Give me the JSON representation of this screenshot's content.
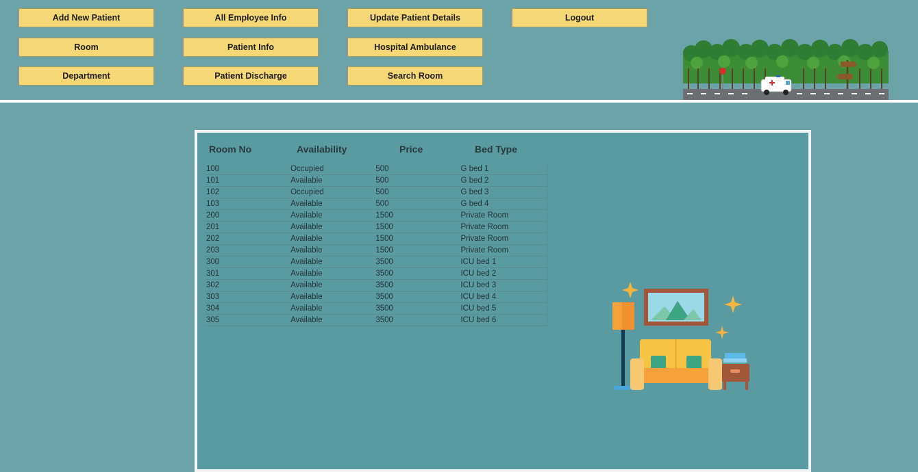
{
  "toolbar": {
    "add_new_patient": "Add New Patient",
    "all_employee_info": "All Employee Info",
    "update_patient_details": "Update Patient Details",
    "logout": "Logout",
    "room": "Room",
    "patient_info": "Patient Info",
    "hospital_ambulance": "Hospital Ambulance",
    "department": "Department",
    "patient_discharge": "Patient Discharge",
    "search_room": "Search Room"
  },
  "room_table": {
    "headers": [
      "Room No",
      "Availability",
      "Price",
      "Bed Type"
    ],
    "rows": [
      [
        "100",
        "Occupied",
        "500",
        "G bed 1"
      ],
      [
        "101",
        "Available",
        "500",
        "G bed 2"
      ],
      [
        "102",
        "Occupied",
        "500",
        "G bed 3"
      ],
      [
        "103",
        "Available",
        "500",
        "G bed 4"
      ],
      [
        "200",
        "Available",
        "1500",
        "Private Room"
      ],
      [
        "201",
        "Available",
        "1500",
        "Private Room"
      ],
      [
        "202",
        "Available",
        "1500",
        "Private Room"
      ],
      [
        "203",
        "Available",
        "1500",
        "Private Room"
      ],
      [
        "300",
        "Available",
        "3500",
        "ICU bed 1"
      ],
      [
        "301",
        "Available",
        "3500",
        "ICU bed 2"
      ],
      [
        "302",
        "Available",
        "3500",
        "ICU bed 3"
      ],
      [
        "303",
        "Available",
        "3500",
        "ICU bed 4"
      ],
      [
        "304",
        "Available",
        "3500",
        "ICU bed 5"
      ],
      [
        "305",
        "Available",
        "3500",
        "ICU bed 6"
      ]
    ]
  },
  "icons": {
    "header_scene": "ambulance-road-forest-illustration",
    "room_illustration": "sofa-living-room-illustration"
  },
  "colors": {
    "page_bg": "#6ca3a8",
    "panel_bg": "#5a9ba2",
    "button_bg": "#f5d775",
    "panel_border": "#f2f4f4"
  }
}
